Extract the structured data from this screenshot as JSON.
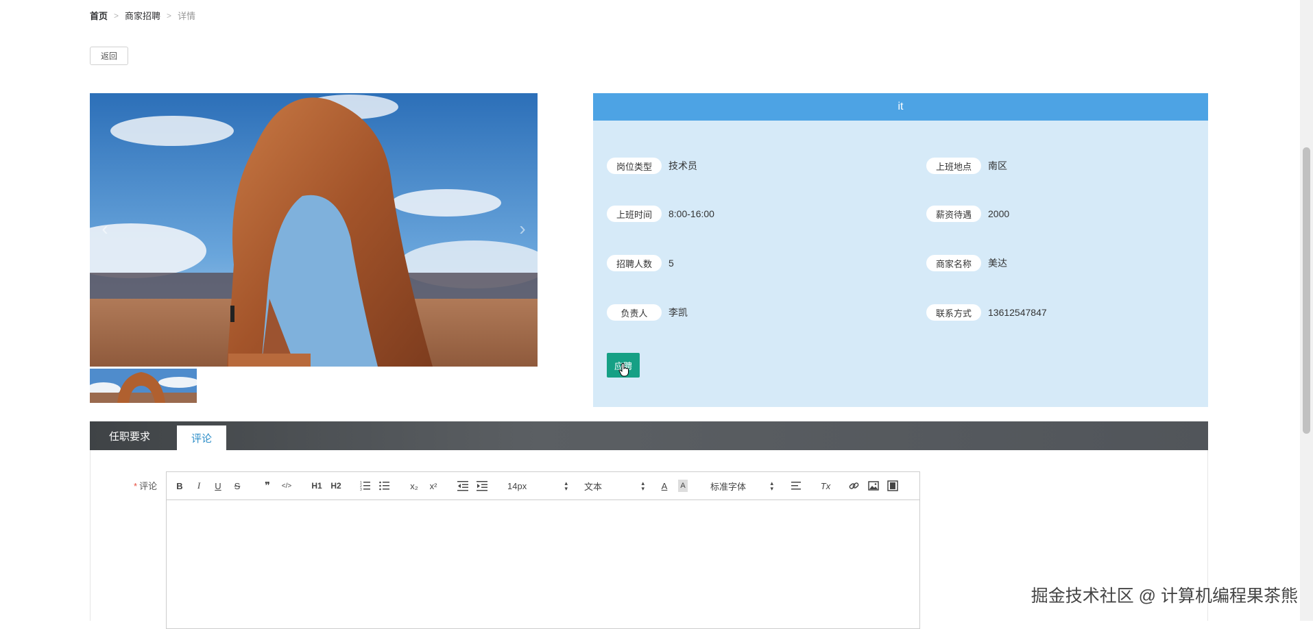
{
  "breadcrumb": {
    "home": "首页",
    "section": "商家招聘",
    "current": "详情",
    "separator": ">"
  },
  "back_button": {
    "label": "返回"
  },
  "carousel": {
    "prev_icon": "chevron-left-icon",
    "next_icon": "chevron-right-icon",
    "prev_glyph": "‹",
    "next_glyph": "›"
  },
  "job": {
    "title": "it",
    "fields": {
      "position_type": {
        "label": "岗位类型",
        "value": "技术员"
      },
      "work_location": {
        "label": "上班地点",
        "value": "南区"
      },
      "work_time": {
        "label": "上班时间",
        "value": "8:00-16:00"
      },
      "salary": {
        "label": "薪资待遇",
        "value": "2000"
      },
      "headcount": {
        "label": "招聘人数",
        "value": "5"
      },
      "merchant_name": {
        "label": "商家名称",
        "value": "美达"
      },
      "contact_person": {
        "label": "负责人",
        "value": "李凯"
      },
      "contact_info": {
        "label": "联系方式",
        "value": "13612547847"
      }
    },
    "apply_label": "应聘"
  },
  "tabs": {
    "requirements": "任职要求",
    "comments": "评论"
  },
  "comment_form": {
    "required_mark": "*",
    "label": "评论",
    "toolbar": {
      "bold": "B",
      "italic": "I",
      "underline": "U",
      "strike": "S",
      "quote": "❞",
      "code": "</>",
      "h1": "H1",
      "h2": "H2",
      "ordered_list": "ordered-list-icon",
      "bullet_list": "bullet-list-icon",
      "subscript": "x₂",
      "superscript": "x²",
      "outdent": "outdent-icon",
      "indent": "indent-icon",
      "font_size": "14px",
      "text_style": "文本",
      "font_family": "标准字体",
      "font_color": "A",
      "background_color": "A",
      "align": "align-icon",
      "clear_format": "Tx",
      "link": "link-icon",
      "image": "image-icon",
      "video": "video-icon"
    }
  },
  "watermark": "掘金技术社区 @ 计算机编程果茶熊",
  "colors": {
    "header_blue": "#4da3e4",
    "panel_bg": "#d6eaf8",
    "apply_green": "#16a085",
    "tab_active_text": "#2d8ec8"
  }
}
